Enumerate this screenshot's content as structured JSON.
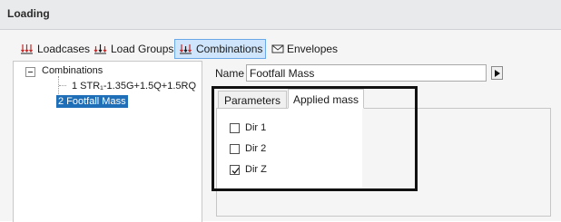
{
  "window": {
    "title": "Loading"
  },
  "ribbon": {
    "tabs": [
      {
        "label": "Loadcases",
        "icon": "loadcases-icon",
        "active": false
      },
      {
        "label": "Load Groups",
        "icon": "load-groups-icon",
        "active": false
      },
      {
        "label": "Combinations",
        "icon": "combinations-icon",
        "active": true
      },
      {
        "label": "Envelopes",
        "icon": "envelopes-icon",
        "active": false
      }
    ]
  },
  "tree": {
    "root": "Combinations",
    "items": [
      {
        "label": "1 STR₁-1.35G+1.5Q+1.5RQ",
        "selected": false
      },
      {
        "label": "2 Footfall Mass",
        "selected": true
      }
    ]
  },
  "name": {
    "label": "Name",
    "value": "Footfall Mass"
  },
  "tabs": [
    {
      "label": "Parameters",
      "active": false
    },
    {
      "label": "Applied mass",
      "active": true
    }
  ],
  "checkboxes": [
    {
      "label": "Dir 1",
      "checked": false
    },
    {
      "label": "Dir 2",
      "checked": false
    },
    {
      "label": "Dir Z",
      "checked": true
    }
  ],
  "colors": {
    "accent": "#1e6fb8",
    "active_tab": "#cfe5fb",
    "highlight": "#111111"
  }
}
